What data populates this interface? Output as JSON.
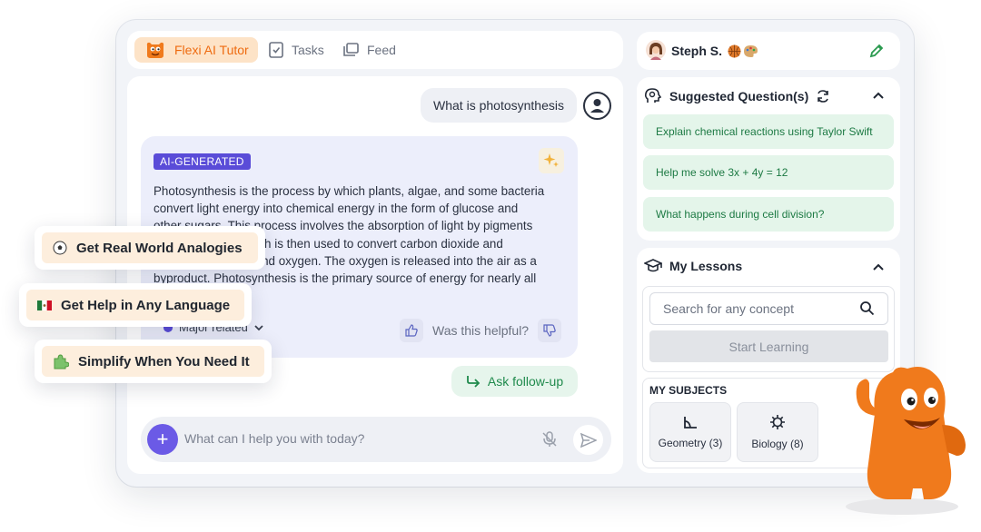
{
  "nav": {
    "tabs": [
      {
        "label": "Flexi AI Tutor",
        "icon": "flexi-mascot-icon",
        "active": true
      },
      {
        "label": "Tasks",
        "icon": "checklist-icon",
        "active": false
      },
      {
        "label": "Feed",
        "icon": "feed-icon",
        "active": false
      }
    ]
  },
  "chat": {
    "user_message": "What is photosynthesis",
    "ai_badge": "AI-GENERATED",
    "ai_response_lines": [
      "Photosynthesis is the process by which plants, algae, and some bacteria",
      "convert light energy into chemical energy in the form of glucose and",
      "other sugars. This process involves the absorption of light by pigments",
      "like chlorophyll, which is then used to convert carbon dioxide and",
      "water into glucose and oxygen. The oxygen is released into the air as a",
      "byproduct. Photosynthesis is the primary source of energy for nearly all"
    ],
    "major_related": "Major related",
    "helpful_label": "Was this helpful?",
    "followup_label": "Ask follow-up",
    "composer_placeholder": "What can I help you with today?"
  },
  "features": [
    {
      "label": "Get Real World Analogies",
      "icon": "soccer-ball-icon"
    },
    {
      "label": "Get Help in Any Language",
      "icon": "mexico-flag-icon"
    },
    {
      "label": "Simplify When You Need It",
      "icon": "puzzle-piece-icon"
    }
  ],
  "profile": {
    "name": "Steph S.",
    "badges": [
      "basketball-icon",
      "palette-icon"
    ]
  },
  "suggested": {
    "title": "Suggested Question(s)",
    "questions": [
      "Explain chemical reactions using Taylor Swift",
      "Help me solve 3x + 4y = 12",
      "What happens during cell division?"
    ]
  },
  "lessons": {
    "title": "My Lessons",
    "search_placeholder": "Search for any concept",
    "start_label": "Start Learning",
    "subjects_title": "MY SUBJECTS",
    "subjects": [
      {
        "label": "Geometry (3)",
        "icon": "protractor-icon"
      },
      {
        "label": "Biology (8)",
        "icon": "virus-icon"
      }
    ]
  },
  "colors": {
    "brand_orange": "#ee6b10",
    "ai_purple": "#5a4cd8",
    "suggest_green": "#1d7a44"
  }
}
